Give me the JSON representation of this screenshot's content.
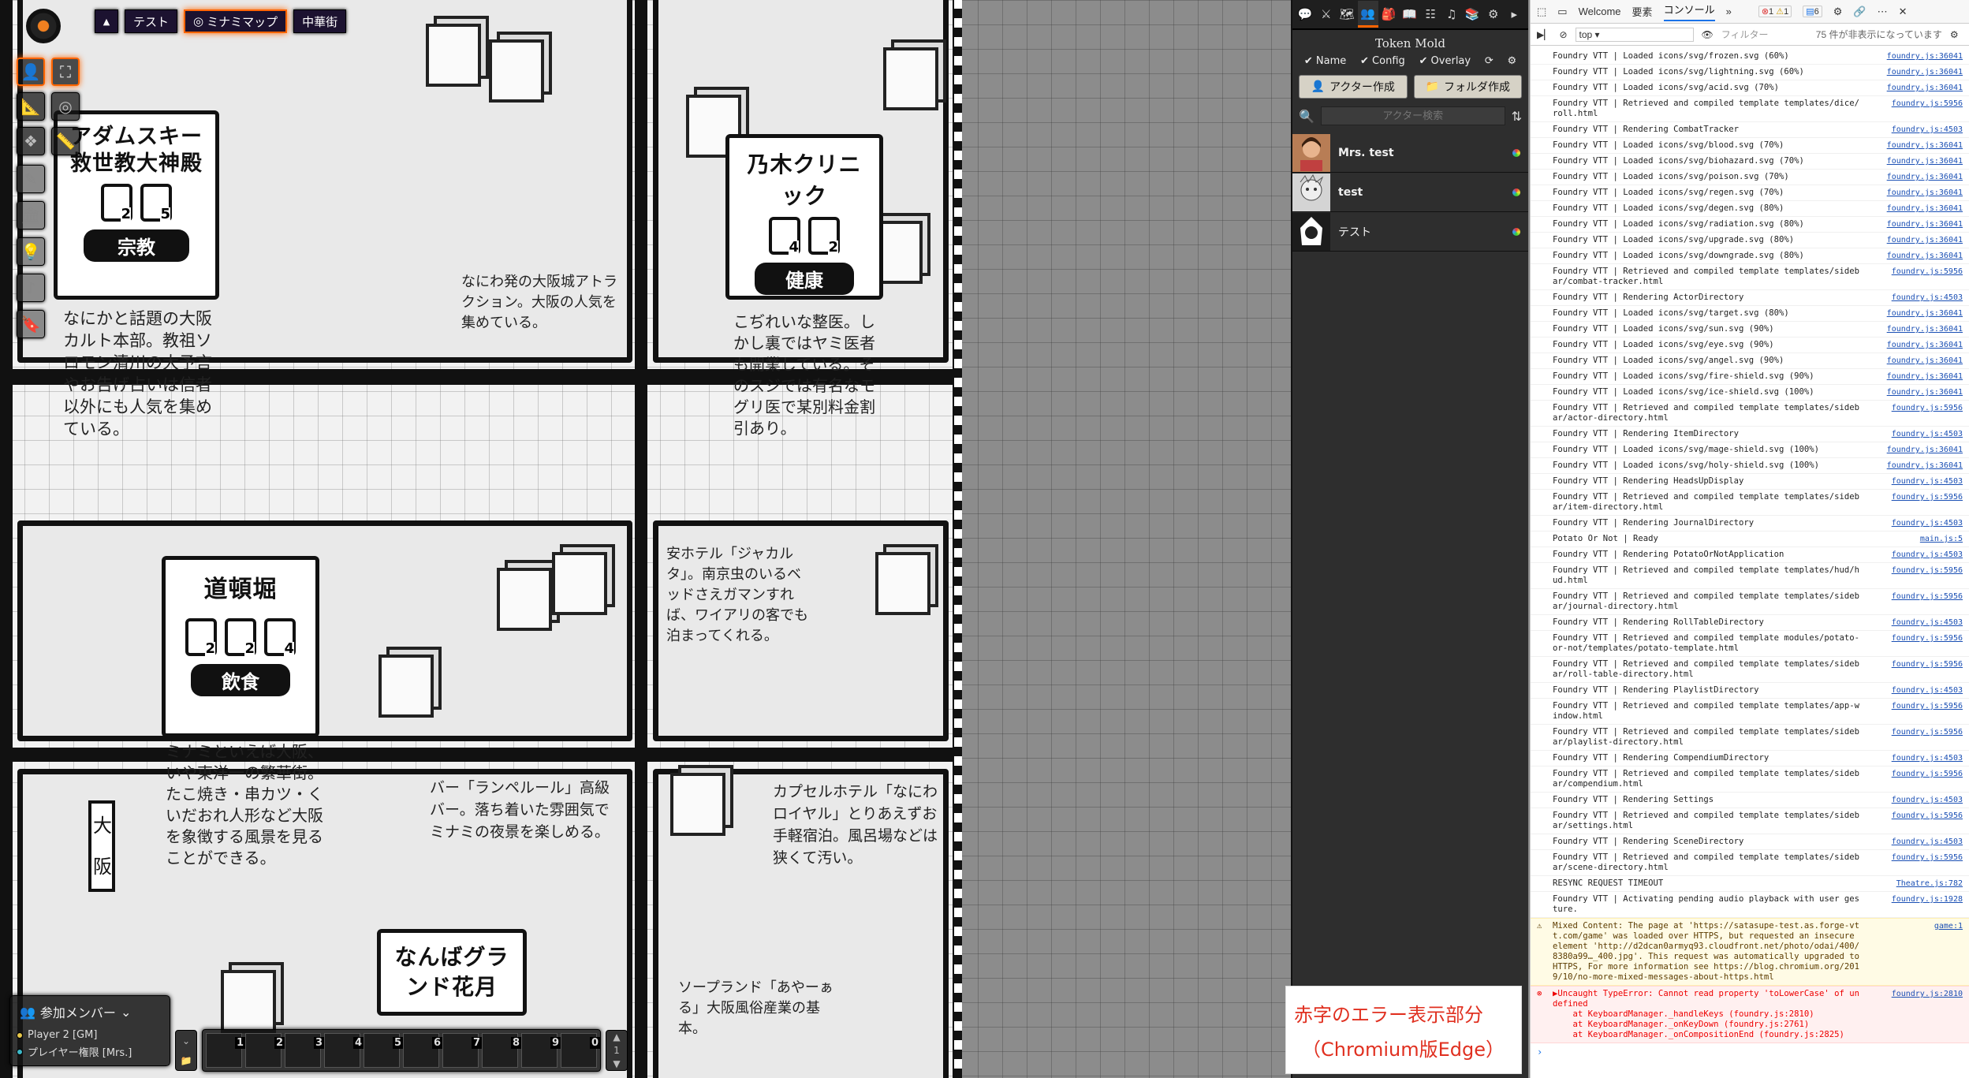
{
  "scene_nav": {
    "toggle_icon": "caret-up",
    "scenes": [
      {
        "label": "テスト",
        "active": false,
        "icon": ""
      },
      {
        "label": "ミナミマップ",
        "active": true,
        "icon": "target-icon"
      },
      {
        "label": "中華街",
        "active": false,
        "icon": ""
      }
    ]
  },
  "controls": {
    "primary": [
      "token-icon",
      "expand-icon"
    ],
    "secondary": [
      "measure-icon",
      "target-icon",
      "tiles-icon",
      "ruler-icon",
      "draw-icon",
      "wall-icon",
      "light-icon",
      "sound-icon",
      "note-icon"
    ]
  },
  "map": {
    "areas": [
      {
        "title": "アダムスキー救世教大神殿",
        "category": "宗教",
        "icons": [
          "2",
          "5"
        ],
        "desc": "なにかと話題の大阪カルト本部。教祖ソロモン清川の大予言やお告げ占いは信者以外にも人気を集めている。"
      },
      {
        "title": "乃木クリニック",
        "category": "健康",
        "icons": [
          "4",
          "2"
        ],
        "desc": "こぢれいな整医。しかし裏ではヤミ医者も開業している。そのスジでは有名なモグリ医で某別料金割引あり。"
      },
      {
        "title": "道頓堀",
        "category": "飲食",
        "icons": [
          "2",
          "2",
          "4"
        ],
        "desc": "ミナミといえば大阪、いや東洋一の繁華街。たこ焼き・串カツ・くいだおれ人形など大阪を象徴する風景を見ることができる。"
      },
      {
        "title": "なんばグランド花月",
        "category": "",
        "icons": [],
        "desc": ""
      }
    ],
    "notes": [
      "なにわ発の大阪城アトラクション。大阪の人気を集めている。",
      "安ホテル「ジャカルタ」。南京虫のいるベッドさえガマンすれば、ワイアリの客でも泊まってくれる。",
      "バー「ランペルール」高級バー。落ち着いた雰囲気でミナミの夜景を楽しめる。",
      "カプセルホテル「なにわロイヤル」とりあえずお手軽宿泊。風呂場などは狭くて汚い。",
      "ソープランド「あやーぁる」大阪風俗産業の基本。"
    ],
    "sign_osaka": "大阪"
  },
  "players": {
    "title": "参加メンバー",
    "list": [
      {
        "name": "Player 2 [GM]",
        "color": "#e8c84a"
      },
      {
        "name": "プレイヤー権限 [Mrs.]",
        "color": "#3cb8c8"
      }
    ]
  },
  "hotbar": {
    "macros": [
      "1",
      "2",
      "3",
      "4",
      "5",
      "6",
      "7",
      "8",
      "9",
      "0"
    ],
    "page": "1"
  },
  "sidebar": {
    "tabs": [
      "chat-icon",
      "combat-icon",
      "scenes-icon",
      "actors-icon",
      "items-icon",
      "journal-icon",
      "tables-icon",
      "playlists-icon",
      "compendium-icon",
      "settings-icon",
      "collapse-icon"
    ],
    "active_tab": 3,
    "header": "Token Mold",
    "options": {
      "name": "Name",
      "config": "Config",
      "overlay": "Overlay"
    },
    "create_actor": "アクター作成",
    "create_folder": "フォルダ作成",
    "search_placeholder": "アクター検索",
    "actors": [
      {
        "name": "Mrs. test",
        "avatar": "portrait"
      },
      {
        "name": "test",
        "avatar": "portrait"
      },
      {
        "name": "テスト",
        "avatar": "hooded"
      }
    ]
  },
  "devtools": {
    "tabs": [
      "Welcome",
      "要素",
      "コンソール"
    ],
    "active_tab": "コンソール",
    "counts": {
      "errors": "1",
      "warnings": "1",
      "info": "6"
    },
    "context": "top",
    "filter_placeholder": "フィルター",
    "hidden_note": "75 件が非表示になっています",
    "logs": [
      {
        "msg": "Foundry VTT | Loaded icons/svg/frozen.svg (60%)",
        "src": "foundry.js:36041"
      },
      {
        "msg": "Foundry VTT | Loaded icons/svg/lightning.svg (60%)",
        "src": "foundry.js:36041"
      },
      {
        "msg": "Foundry VTT | Loaded icons/svg/acid.svg (70%)",
        "src": "foundry.js:36041"
      },
      {
        "msg": "Foundry VTT | Retrieved and compiled template templates/dice/roll.html",
        "src": "foundry.js:5956"
      },
      {
        "msg": "Foundry VTT | Rendering CombatTracker",
        "src": "foundry.js:4503"
      },
      {
        "msg": "Foundry VTT | Loaded icons/svg/blood.svg (70%)",
        "src": "foundry.js:36041"
      },
      {
        "msg": "Foundry VTT | Loaded icons/svg/biohazard.svg (70%)",
        "src": "foundry.js:36041"
      },
      {
        "msg": "Foundry VTT | Loaded icons/svg/poison.svg (70%)",
        "src": "foundry.js:36041"
      },
      {
        "msg": "Foundry VTT | Loaded icons/svg/regen.svg (70%)",
        "src": "foundry.js:36041"
      },
      {
        "msg": "Foundry VTT | Loaded icons/svg/degen.svg (80%)",
        "src": "foundry.js:36041"
      },
      {
        "msg": "Foundry VTT | Loaded icons/svg/radiation.svg (80%)",
        "src": "foundry.js:36041"
      },
      {
        "msg": "Foundry VTT | Loaded icons/svg/upgrade.svg (80%)",
        "src": "foundry.js:36041"
      },
      {
        "msg": "Foundry VTT | Loaded icons/svg/downgrade.svg (80%)",
        "src": "foundry.js:36041"
      },
      {
        "msg": "Foundry VTT | Retrieved and compiled template templates/sidebar/combat-tracker.html",
        "src": "foundry.js:5956"
      },
      {
        "msg": "Foundry VTT | Rendering ActorDirectory",
        "src": "foundry.js:4503"
      },
      {
        "msg": "Foundry VTT | Loaded icons/svg/target.svg (80%)",
        "src": "foundry.js:36041"
      },
      {
        "msg": "Foundry VTT | Loaded icons/svg/sun.svg (90%)",
        "src": "foundry.js:36041"
      },
      {
        "msg": "Foundry VTT | Loaded icons/svg/eye.svg (90%)",
        "src": "foundry.js:36041"
      },
      {
        "msg": "Foundry VTT | Loaded icons/svg/angel.svg (90%)",
        "src": "foundry.js:36041"
      },
      {
        "msg": "Foundry VTT | Loaded icons/svg/fire-shield.svg (90%)",
        "src": "foundry.js:36041"
      },
      {
        "msg": "Foundry VTT | Loaded icons/svg/ice-shield.svg (100%)",
        "src": "foundry.js:36041"
      },
      {
        "msg": "Foundry VTT | Retrieved and compiled template templates/sidebar/actor-directory.html",
        "src": "foundry.js:5956"
      },
      {
        "msg": "Foundry VTT | Rendering ItemDirectory",
        "src": "foundry.js:4503"
      },
      {
        "msg": "Foundry VTT | Loaded icons/svg/mage-shield.svg (100%)",
        "src": "foundry.js:36041"
      },
      {
        "msg": "Foundry VTT | Loaded icons/svg/holy-shield.svg (100%)",
        "src": "foundry.js:36041"
      },
      {
        "msg": "Foundry VTT | Rendering HeadsUpDisplay",
        "src": "foundry.js:4503"
      },
      {
        "msg": "Foundry VTT | Retrieved and compiled template templates/sidebar/item-directory.html",
        "src": "foundry.js:5956"
      },
      {
        "msg": "Foundry VTT | Rendering JournalDirectory",
        "src": "foundry.js:4503"
      },
      {
        "msg": "Potato Or Not | Ready",
        "src": "main.js:5"
      },
      {
        "msg": "Foundry VTT | Rendering PotatoOrNotApplication",
        "src": "foundry.js:4503"
      },
      {
        "msg": "Foundry VTT | Retrieved and compiled template templates/hud/hud.html",
        "src": "foundry.js:5956"
      },
      {
        "msg": "Foundry VTT | Retrieved and compiled template templates/sidebar/journal-directory.html",
        "src": "foundry.js:5956"
      },
      {
        "msg": "Foundry VTT | Rendering RollTableDirectory",
        "src": "foundry.js:4503"
      },
      {
        "msg": "Foundry VTT | Retrieved and compiled template modules/potato-or-not/templates/potato-template.html",
        "src": "foundry.js:5956"
      },
      {
        "msg": "Foundry VTT | Retrieved and compiled template templates/sidebar/roll-table-directory.html",
        "src": "foundry.js:5956"
      },
      {
        "msg": "Foundry VTT | Rendering PlaylistDirectory",
        "src": "foundry.js:4503"
      },
      {
        "msg": "Foundry VTT | Retrieved and compiled template templates/app-window.html",
        "src": "foundry.js:5956"
      },
      {
        "msg": "Foundry VTT | Retrieved and compiled template templates/sidebar/playlist-directory.html",
        "src": "foundry.js:5956"
      },
      {
        "msg": "Foundry VTT | Rendering CompendiumDirectory",
        "src": "foundry.js:4503"
      },
      {
        "msg": "Foundry VTT | Retrieved and compiled template templates/sidebar/compendium.html",
        "src": "foundry.js:5956"
      },
      {
        "msg": "Foundry VTT | Rendering Settings",
        "src": "foundry.js:4503"
      },
      {
        "msg": "Foundry VTT | Retrieved and compiled template templates/sidebar/settings.html",
        "src": "foundry.js:5956"
      },
      {
        "msg": "Foundry VTT | Rendering SceneDirectory",
        "src": "foundry.js:4503"
      },
      {
        "msg": "Foundry VTT | Retrieved and compiled template templates/sidebar/scene-directory.html",
        "src": "foundry.js:5956"
      },
      {
        "msg": "RESYNC REQUEST TIMEOUT",
        "src": "Theatre.js:782"
      },
      {
        "msg": "Foundry VTT | Activating pending audio playback with user gesture.",
        "src": "foundry.js:1928"
      }
    ],
    "warning": {
      "msg": "Mixed Content: The page at 'https://satasupe-test.as.forge-vtt.com/game' was loaded over HTTPS, but requested an insecure element 'http://d2dcan0armyq93.cloudfront.net/photo/odai/400/8380a99…_400.jpg'. This request was automatically upgraded to HTTPS, For more information see https://blog.chromium.org/2019/10/no-more-mixed-messages-about-https.html",
      "src": "game:1"
    },
    "error": {
      "msg": "▶Uncaught TypeError: Cannot read property 'toLowerCase' of undefined\n    at KeyboardManager._handleKeys (foundry.js:2810)\n    at KeyboardManager._onKeyDown (foundry.js:2761)\n    at KeyboardManager._onCompositionEnd (foundry.js:2825)",
      "src": "foundry.js:2810"
    }
  },
  "annotation": {
    "line1": "赤字のエラー表示部分",
    "line2": "（Chromium版Edge）"
  }
}
